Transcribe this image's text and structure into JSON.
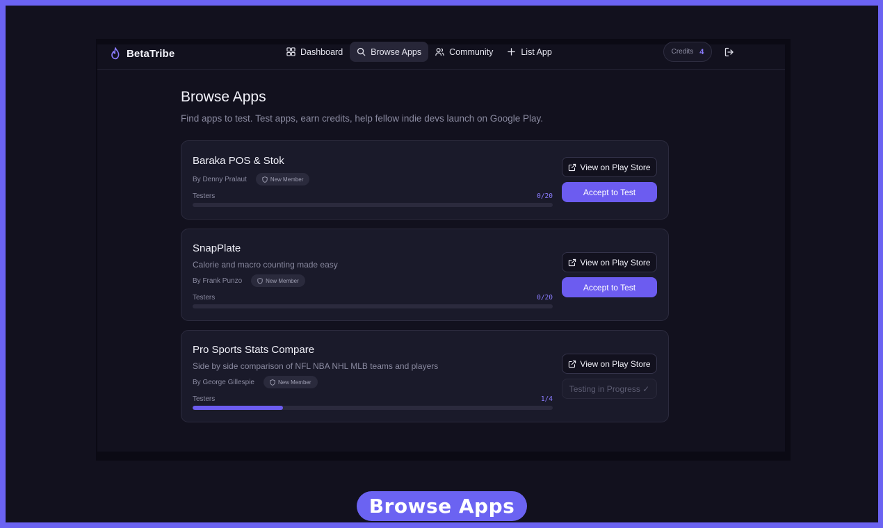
{
  "brand": {
    "name": "BetaTribe",
    "icon": "flame-icon",
    "accent": "#6c5cf0"
  },
  "nav": [
    {
      "label": "Dashboard",
      "icon": "grid-icon",
      "active": false
    },
    {
      "label": "Browse Apps",
      "icon": "search-icon",
      "active": true
    },
    {
      "label": "Community",
      "icon": "users-icon",
      "active": false
    },
    {
      "label": "List App",
      "icon": "plus-icon",
      "active": false
    }
  ],
  "credits": {
    "label": "Credits",
    "value": "4"
  },
  "logout_icon": "logout-icon",
  "page": {
    "title": "Browse Apps",
    "subtitle": "Find apps to test. Test apps, earn credits, help fellow indie devs launch on Google Play."
  },
  "apps": [
    {
      "title": "Baraka POS & Stok",
      "description": "",
      "by": "By Denny Pralaut",
      "badge": "New Member",
      "testers_label": "Testers",
      "testers_count": "0/20",
      "progress": 0,
      "play_label": "View on Play Store",
      "action_label": "Accept to Test",
      "action_state": "accept"
    },
    {
      "title": "SnapPlate",
      "description": "Calorie and macro counting made easy",
      "by": "By Frank Punzo",
      "badge": "New Member",
      "testers_label": "Testers",
      "testers_count": "0/20",
      "progress": 0,
      "play_label": "View on Play Store",
      "action_label": "Accept to Test",
      "action_state": "accept"
    },
    {
      "title": "Pro Sports Stats Compare",
      "description": "Side by side comparison of NFL NBA NHL MLB teams and players",
      "by": "By George Gillespie",
      "badge": "New Member",
      "testers_label": "Testers",
      "testers_count": "1/4",
      "progress": 0.25,
      "play_label": "View on Play Store",
      "action_label": "Testing in Progress ✓",
      "action_state": "in-progress"
    }
  ],
  "caption": "Browse Apps"
}
